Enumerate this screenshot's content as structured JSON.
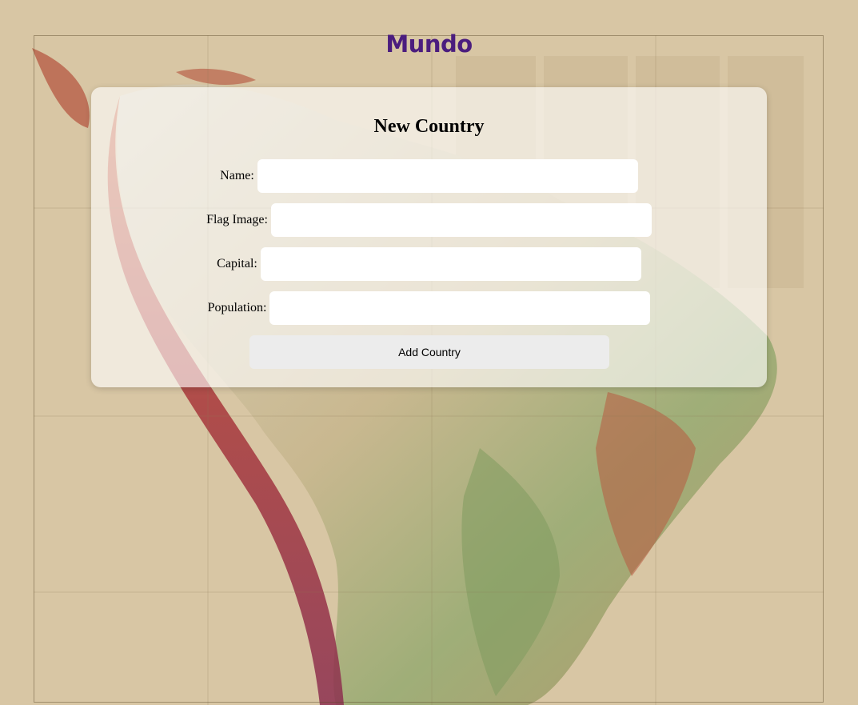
{
  "header": {
    "brand": "Mundo"
  },
  "form": {
    "title": "New Country",
    "fields": [
      {
        "label": "Name:",
        "value": "",
        "placeholder": ""
      },
      {
        "label": "Flag Image:",
        "value": "",
        "placeholder": ""
      },
      {
        "label": "Capital:",
        "value": "",
        "placeholder": ""
      },
      {
        "label": "Population:",
        "value": "",
        "placeholder": ""
      }
    ],
    "submit_label": "Add Country"
  },
  "colors": {
    "brand": "#4b1d7e",
    "page_background": "#d8c6a4",
    "card_background": "rgba(255,255,255,0.62)",
    "button_background": "#ececec"
  },
  "icons": {
    "background": "south-america-relief-map"
  }
}
